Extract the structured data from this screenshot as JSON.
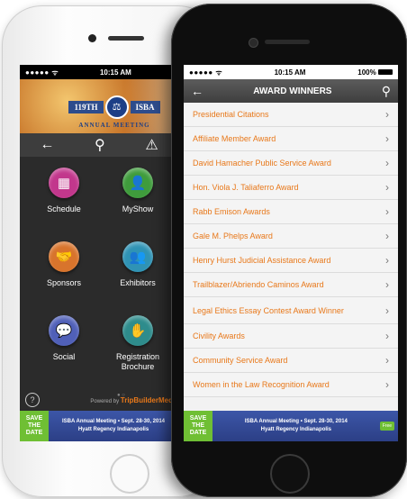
{
  "back_phone": {
    "status": {
      "signal": "●●●●● ",
      "wifi": "ᯤ",
      "time": "10:15 AM"
    },
    "banner": {
      "ribbon_left": "119TH",
      "seal": "⚖",
      "ribbon_right": "ISBA",
      "caption": "ANNUAL MEETING"
    },
    "toolbar": {
      "back_icon": "←",
      "search_icon": "⚲",
      "alert_icon": "⚠"
    },
    "tiles": [
      {
        "label": "Schedule",
        "icon": "▦",
        "color": "#c2378c"
      },
      {
        "label": "MyShow",
        "icon": "👤",
        "color": "#3f9c3c"
      },
      {
        "label": "Sponsors",
        "icon": "🤝",
        "color": "#d8742c"
      },
      {
        "label": "Exhibitors",
        "icon": "👥",
        "color": "#2f93b5"
      },
      {
        "label": "Social",
        "icon": "💬",
        "color": "#5060b8"
      },
      {
        "label": "Registration Brochure",
        "icon": "✋",
        "color": "#2e8c8c"
      }
    ],
    "help_icon": "?",
    "page_dots": "● ○",
    "powered_prefix": "Powered by ",
    "powered_brand": "TripBuilderMed"
  },
  "front_phone": {
    "status": {
      "signal": "●●●●● ",
      "wifi": "ᯤ",
      "time": "10:15 AM",
      "battery": "100%"
    },
    "nav": {
      "back_icon": "←",
      "title": "AWARD WINNERS",
      "search_icon": "⚲"
    },
    "awards": [
      "Presidential Citations",
      "Affiliate Member Award",
      "David Hamacher Public Service Award",
      "Hon. Viola J. Taliaferro Award",
      "Rabb Emison Awards",
      "Gale M. Phelps Award",
      "Henry Hurst Judicial Assistance Award",
      "Trailblazer/Abriendo Caminos Award",
      "Legal Ethics Essay Contest Award Winner",
      "Civility Awards",
      "Community Service Award",
      "Women in the Law Recognition Award"
    ]
  },
  "ad": {
    "save_1": "SAVE",
    "save_2": "THE",
    "save_3": "DATE",
    "line_1": "ISBA Annual Meeting • Sept. 28-30, 2014",
    "line_2": "Hyatt Regency Indianapolis",
    "button": "Free"
  },
  "colors": {
    "accent": "#e8781a",
    "ad_blue": "#2c3f86",
    "save_green": "#6fbf34"
  }
}
